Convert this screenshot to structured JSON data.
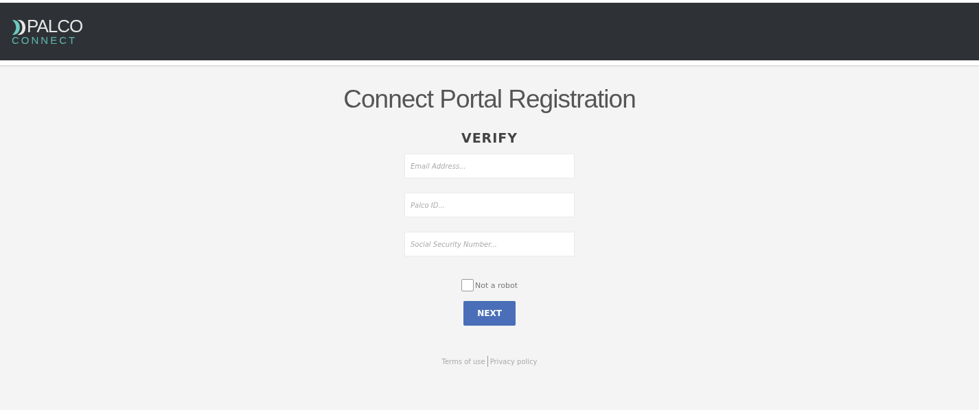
{
  "header": {
    "logo": {
      "name": "PALCO",
      "tagline": "CONNECT"
    }
  },
  "title": "Connect Portal Registration",
  "form": {
    "heading": "VERIFY",
    "fields": [
      {
        "placeholder": "Email Address..."
      },
      {
        "placeholder": "Palco ID..."
      },
      {
        "placeholder": "Social Security Number..."
      }
    ],
    "captcha": {
      "label": "Not a robot",
      "checked": false
    },
    "submit": "NEXT"
  },
  "footer": {
    "links": [
      "Terms of use",
      "Privacy policy"
    ]
  }
}
